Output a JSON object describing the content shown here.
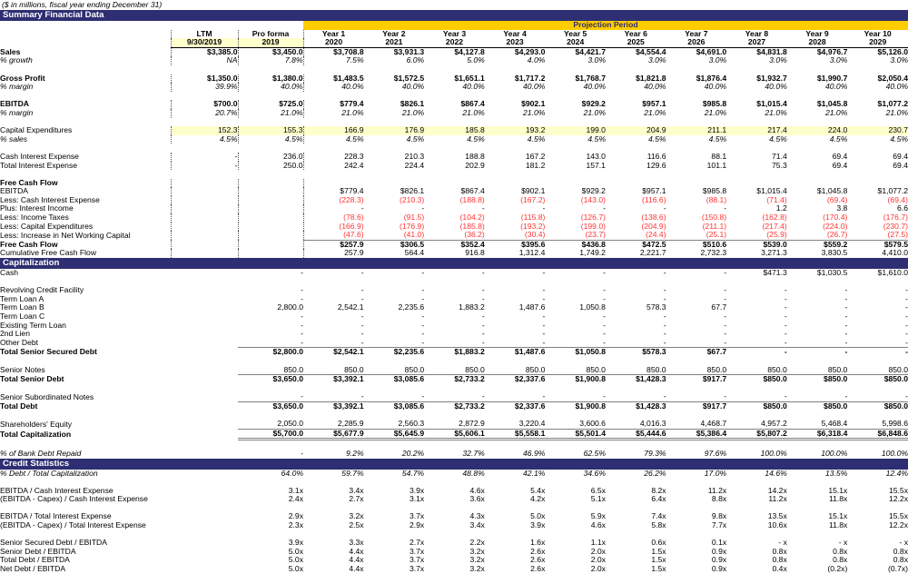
{
  "document": {
    "subtitle": "($ in millions, fiscal year ending December 31)"
  },
  "sections": {
    "summary_title": "Summary Financial Data",
    "capitalization_title": "Capitalization",
    "credit_title": "Credit Statistics"
  },
  "header": {
    "projection_band": "Projection Period",
    "ltm_line1": "LTM",
    "ltm_line2": "9/30/2019",
    "pf_line1": "Pro forma",
    "pf_line2": "2019",
    "years": [
      {
        "label": "Year 1",
        "year": "2020"
      },
      {
        "label": "Year 2",
        "year": "2021"
      },
      {
        "label": "Year 3",
        "year": "2022"
      },
      {
        "label": "Year 4",
        "year": "2023"
      },
      {
        "label": "Year 5",
        "year": "2024"
      },
      {
        "label": "Year 6",
        "year": "2025"
      },
      {
        "label": "Year 7",
        "year": "2026"
      },
      {
        "label": "Year 8",
        "year": "2027"
      },
      {
        "label": "Year 9",
        "year": "2028"
      },
      {
        "label": "Year 10",
        "year": "2029"
      }
    ]
  },
  "summary_rows": [
    {
      "label": "Sales",
      "style": "bold",
      "values": [
        "$3,385.0",
        "$3,450.0",
        "$3,708.8",
        "$3,931.3",
        "$4,127.8",
        "$4,293.0",
        "$4,421.7",
        "$4,554.4",
        "$4,691.0",
        "$4,831.8",
        "$4,976.7",
        "$5,126.0"
      ]
    },
    {
      "label": "% growth",
      "style": "italic-indent",
      "values": [
        "NA",
        "7.8%",
        "7.5%",
        "6.0%",
        "5.0%",
        "4.0%",
        "3.0%",
        "3.0%",
        "3.0%",
        "3.0%",
        "3.0%",
        "3.0%"
      ]
    },
    {
      "label": "",
      "style": "gap",
      "values": []
    },
    {
      "label": "Gross Profit",
      "style": "bold",
      "values": [
        "$1,350.0",
        "$1,380.0",
        "$1,483.5",
        "$1,572.5",
        "$1,651.1",
        "$1,717.2",
        "$1,768.7",
        "$1,821.8",
        "$1,876.4",
        "$1,932.7",
        "$1,990.7",
        "$2,050.4"
      ]
    },
    {
      "label": "% margin",
      "style": "italic-indent",
      "values": [
        "39.9%",
        "40.0%",
        "40.0%",
        "40.0%",
        "40.0%",
        "40.0%",
        "40.0%",
        "40.0%",
        "40.0%",
        "40.0%",
        "40.0%",
        "40.0%"
      ]
    },
    {
      "label": "",
      "style": "gap",
      "values": []
    },
    {
      "label": "EBITDA",
      "style": "bold",
      "values": [
        "$700.0",
        "$725.0",
        "$779.4",
        "$826.1",
        "$867.4",
        "$902.1",
        "$929.2",
        "$957.1",
        "$985.8",
        "$1,015.4",
        "$1,045.8",
        "$1,077.2"
      ]
    },
    {
      "label": "% margin",
      "style": "italic-indent",
      "values": [
        "20.7%",
        "21.0%",
        "21.0%",
        "21.0%",
        "21.0%",
        "21.0%",
        "21.0%",
        "21.0%",
        "21.0%",
        "21.0%",
        "21.0%",
        "21.0%"
      ]
    },
    {
      "label": "",
      "style": "gap",
      "values": []
    },
    {
      "label": "Capital Expenditures",
      "style": "plain-hl",
      "values": [
        "152.3",
        "155.3",
        "166.9",
        "176.9",
        "185.8",
        "193.2",
        "199.0",
        "204.9",
        "211.1",
        "217.4",
        "224.0",
        "230.7"
      ]
    },
    {
      "label": "% sales",
      "style": "italic-indent",
      "values": [
        "4.5%",
        "4.5%",
        "4.5%",
        "4.5%",
        "4.5%",
        "4.5%",
        "4.5%",
        "4.5%",
        "4.5%",
        "4.5%",
        "4.5%",
        "4.5%"
      ]
    },
    {
      "label": "",
      "style": "gap",
      "values": []
    },
    {
      "label": "Cash Interest Expense",
      "style": "plain",
      "values": [
        "-",
        "236.0",
        "228.3",
        "210.3",
        "188.8",
        "167.2",
        "143.0",
        "116.6",
        "88.1",
        "71.4",
        "69.4",
        "69.4"
      ]
    },
    {
      "label": "Total Interest Expense",
      "style": "plain",
      "values": [
        "-",
        "250.0",
        "242.4",
        "224.4",
        "202.9",
        "181.2",
        "157.1",
        "129.6",
        "101.1",
        "75.3",
        "69.4",
        "69.4"
      ]
    }
  ],
  "fcf_title": "Free Cash Flow",
  "fcf_rows": [
    {
      "label": "EBITDA",
      "style": "plain",
      "skip2": true,
      "values": [
        "$779.4",
        "$826.1",
        "$867.4",
        "$902.1",
        "$929.2",
        "$957.1",
        "$985.8",
        "$1,015.4",
        "$1,045.8",
        "$1,077.2"
      ]
    },
    {
      "label": "Less: Cash Interest Expense",
      "style": "neg",
      "skip2": true,
      "values": [
        "(228.3)",
        "(210.3)",
        "(188.8)",
        "(167.2)",
        "(143.0)",
        "(116.6)",
        "(88.1)",
        "(71.4)",
        "(69.4)",
        "(69.4)"
      ]
    },
    {
      "label": "Plus: Interest Income",
      "style": "plain",
      "skip2": true,
      "values": [
        "-",
        "-",
        "-",
        "-",
        "-",
        "-",
        "-",
        "1.2",
        "3.8",
        "6.6"
      ]
    },
    {
      "label": "Less: Income Taxes",
      "style": "neg",
      "skip2": true,
      "values": [
        "(78.6)",
        "(91.5)",
        "(104.2)",
        "(115.8)",
        "(126.7)",
        "(138.6)",
        "(150.8)",
        "(162.8)",
        "(170.4)",
        "(176.7)"
      ]
    },
    {
      "label": "Less: Capital Expenditures",
      "style": "neg",
      "skip2": true,
      "values": [
        "(166.9)",
        "(176.9)",
        "(185.8)",
        "(193.2)",
        "(199.0)",
        "(204.9)",
        "(211.1)",
        "(217.4)",
        "(224.0)",
        "(230.7)"
      ]
    },
    {
      "label": "Less: Increase in Net Working Capital",
      "style": "neg-line",
      "skip2": true,
      "values": [
        "(47.6)",
        "(41.0)",
        "(36.2)",
        "(30.4)",
        "(23.7)",
        "(24.4)",
        "(25.1)",
        "(25.9)",
        "(26.7)",
        "(27.5)"
      ]
    },
    {
      "label": "Free Cash Flow",
      "style": "bold-indent",
      "skip2": true,
      "values": [
        "$257.9",
        "$306.5",
        "$352.4",
        "$395.6",
        "$436.8",
        "$472.5",
        "$510.6",
        "$539.0",
        "$559.2",
        "$579.5"
      ]
    },
    {
      "label": "Cumulative Free Cash Flow",
      "style": "plain-indent",
      "skip2": true,
      "values": [
        "257.9",
        "564.4",
        "916.8",
        "1,312.4",
        "1,749.2",
        "2,221.7",
        "2,732.3",
        "3,271.3",
        "3,830.5",
        "4,410.0"
      ]
    }
  ],
  "cap_rows": [
    {
      "label": "Cash",
      "style": "plain",
      "values": [
        "-",
        "-",
        "-",
        "-",
        "-",
        "-",
        "-",
        "-",
        "$471.3",
        "$1,030.5",
        "$1,610.0"
      ]
    },
    {
      "label": "",
      "style": "gap",
      "values": []
    },
    {
      "label": "Revolving Credit Facility",
      "style": "plain",
      "values": [
        "-",
        "-",
        "-",
        "-",
        "-",
        "-",
        "-",
        "-",
        "-",
        "-",
        "-"
      ]
    },
    {
      "label": "Term Loan A",
      "style": "plain",
      "values": [
        "-",
        "-",
        "-",
        "-",
        "-",
        "-",
        "-",
        "-",
        "-",
        "-",
        "-"
      ]
    },
    {
      "label": "Term Loan B",
      "style": "plain",
      "values": [
        "2,800.0",
        "2,542.1",
        "2,235.6",
        "1,883.2",
        "1,487.6",
        "1,050.8",
        "578.3",
        "67.7",
        "-",
        "-",
        "-"
      ]
    },
    {
      "label": "Term Loan C",
      "style": "plain",
      "values": [
        "-",
        "-",
        "-",
        "-",
        "-",
        "-",
        "-",
        "-",
        "-",
        "-",
        "-"
      ]
    },
    {
      "label": "Existing Term Loan",
      "style": "plain",
      "values": [
        "-",
        "-",
        "-",
        "-",
        "-",
        "-",
        "-",
        "-",
        "-",
        "-",
        "-"
      ]
    },
    {
      "label": "2nd Lien",
      "style": "plain",
      "values": [
        "-",
        "-",
        "-",
        "-",
        "-",
        "-",
        "-",
        "-",
        "-",
        "-",
        "-"
      ]
    },
    {
      "label": "Other Debt",
      "style": "plain-line",
      "values": [
        "-",
        "-",
        "-",
        "-",
        "-",
        "-",
        "-",
        "-",
        "-",
        "-",
        "-"
      ]
    },
    {
      "label": "Total Senior Secured Debt",
      "style": "bold-indent",
      "values": [
        "$2,800.0",
        "$2,542.1",
        "$2,235.6",
        "$1,883.2",
        "$1,487.6",
        "$1,050.8",
        "$578.3",
        "$67.7",
        "-",
        "-",
        "-"
      ]
    },
    {
      "label": "",
      "style": "gap-sm",
      "values": []
    },
    {
      "label": "Senior Notes",
      "style": "plain-line",
      "values": [
        "850.0",
        "850.0",
        "850.0",
        "850.0",
        "850.0",
        "850.0",
        "850.0",
        "850.0",
        "850.0",
        "850.0",
        "850.0"
      ]
    },
    {
      "label": "Total Senior Debt",
      "style": "bold-indent",
      "values": [
        "$3,650.0",
        "$3,392.1",
        "$3,085.6",
        "$2,733.2",
        "$2,337.6",
        "$1,900.8",
        "$1,428.3",
        "$917.7",
        "$850.0",
        "$850.0",
        "$850.0"
      ]
    },
    {
      "label": "",
      "style": "gap-sm",
      "values": []
    },
    {
      "label": "Senior Subordinated Notes",
      "style": "plain-line",
      "values": [
        "-",
        "-",
        "-",
        "-",
        "-",
        "-",
        "-",
        "-",
        "-",
        "-",
        "-"
      ]
    },
    {
      "label": "Total Debt",
      "style": "bold-indent",
      "values": [
        "$3,650.0",
        "$3,392.1",
        "$3,085.6",
        "$2,733.2",
        "$2,337.6",
        "$1,900.8",
        "$1,428.3",
        "$917.7",
        "$850.0",
        "$850.0",
        "$850.0"
      ]
    },
    {
      "label": "",
      "style": "gap-sm",
      "values": []
    },
    {
      "label": "Shareholders' Equity",
      "style": "plain-line",
      "values": [
        "2,050.0",
        "2,285.9",
        "2,560.3",
        "2,872.9",
        "3,220.4",
        "3,600.6",
        "4,016.3",
        "4,468.7",
        "4,957.2",
        "5,468.4",
        "5,998.6"
      ]
    },
    {
      "label": "Total Capitalization",
      "style": "bold-indent-dbl",
      "values": [
        "$5,700.0",
        "$5,677.9",
        "$5,645.9",
        "$5,606.1",
        "$5,558.1",
        "$5,501.4",
        "$5,444.6",
        "$5,386.4",
        "$5,807.2",
        "$6,318.4",
        "$6,848.6"
      ]
    },
    {
      "label": "",
      "style": "gap-sm",
      "values": []
    },
    {
      "label": "% of Bank Debt Repaid",
      "style": "italic-indent",
      "values": [
        "-",
        "9.2%",
        "20.2%",
        "32.7%",
        "46.9%",
        "62.5%",
        "79.3%",
        "97.6%",
        "100.0%",
        "100.0%",
        "100.0%"
      ]
    }
  ],
  "credit_rows": [
    {
      "label": "% Debt / Total Capitalization",
      "style": "italic",
      "values": [
        "64.0%",
        "59.7%",
        "54.7%",
        "48.8%",
        "42.1%",
        "34.6%",
        "26.2%",
        "17.0%",
        "14.6%",
        "13.5%",
        "12.4%"
      ]
    },
    {
      "label": "",
      "style": "gap-sm",
      "values": []
    },
    {
      "label": "EBITDA / Cash Interest Expense",
      "style": "plain",
      "values": [
        "3.1x",
        "3.4x",
        "3.9x",
        "4.6x",
        "5.4x",
        "6.5x",
        "8.2x",
        "11.2x",
        "14.2x",
        "15.1x",
        "15.5x"
      ]
    },
    {
      "label": "(EBITDA - Capex) / Cash Interest Expense",
      "style": "plain",
      "values": [
        "2.4x",
        "2.7x",
        "3.1x",
        "3.6x",
        "4.2x",
        "5.1x",
        "6.4x",
        "8.8x",
        "11.2x",
        "11.8x",
        "12.2x"
      ]
    },
    {
      "label": "",
      "style": "gap-sm",
      "values": []
    },
    {
      "label": "EBITDA / Total Interest Expense",
      "style": "plain",
      "values": [
        "2.9x",
        "3.2x",
        "3.7x",
        "4.3x",
        "5.0x",
        "5.9x",
        "7.4x",
        "9.8x",
        "13.5x",
        "15.1x",
        "15.5x"
      ]
    },
    {
      "label": "(EBITDA - Capex) / Total Interest Expense",
      "style": "plain",
      "values": [
        "2.3x",
        "2.5x",
        "2.9x",
        "3.4x",
        "3.9x",
        "4.6x",
        "5.8x",
        "7.7x",
        "10.6x",
        "11.8x",
        "12.2x"
      ]
    },
    {
      "label": "",
      "style": "gap-sm",
      "values": []
    },
    {
      "label": "Senior Secured Debt / EBITDA",
      "style": "plain",
      "values": [
        "3.9x",
        "3.3x",
        "2.7x",
        "2.2x",
        "1.6x",
        "1.1x",
        "0.6x",
        "0.1x",
        "- x",
        "- x",
        "- x"
      ]
    },
    {
      "label": "Senior Debt / EBITDA",
      "style": "plain",
      "values": [
        "5.0x",
        "4.4x",
        "3.7x",
        "3.2x",
        "2.6x",
        "2.0x",
        "1.5x",
        "0.9x",
        "0.8x",
        "0.8x",
        "0.8x"
      ]
    },
    {
      "label": "Total Debt / EBITDA",
      "style": "plain",
      "values": [
        "5.0x",
        "4.4x",
        "3.7x",
        "3.2x",
        "2.6x",
        "2.0x",
        "1.5x",
        "0.9x",
        "0.8x",
        "0.8x",
        "0.8x"
      ]
    },
    {
      "label": "Net Debt / EBITDA",
      "style": "plain",
      "values": [
        "5.0x",
        "4.4x",
        "3.7x",
        "3.2x",
        "2.6x",
        "2.0x",
        "1.5x",
        "0.9x",
        "0.4x",
        "(0.2x)",
        "(0.7x)"
      ]
    }
  ],
  "colors": {
    "bar_navy": "#2e2e72",
    "band_yellow": "#ffcc00",
    "highlight_yellow": "#ffffcc",
    "negative_red": "#ff3333"
  }
}
